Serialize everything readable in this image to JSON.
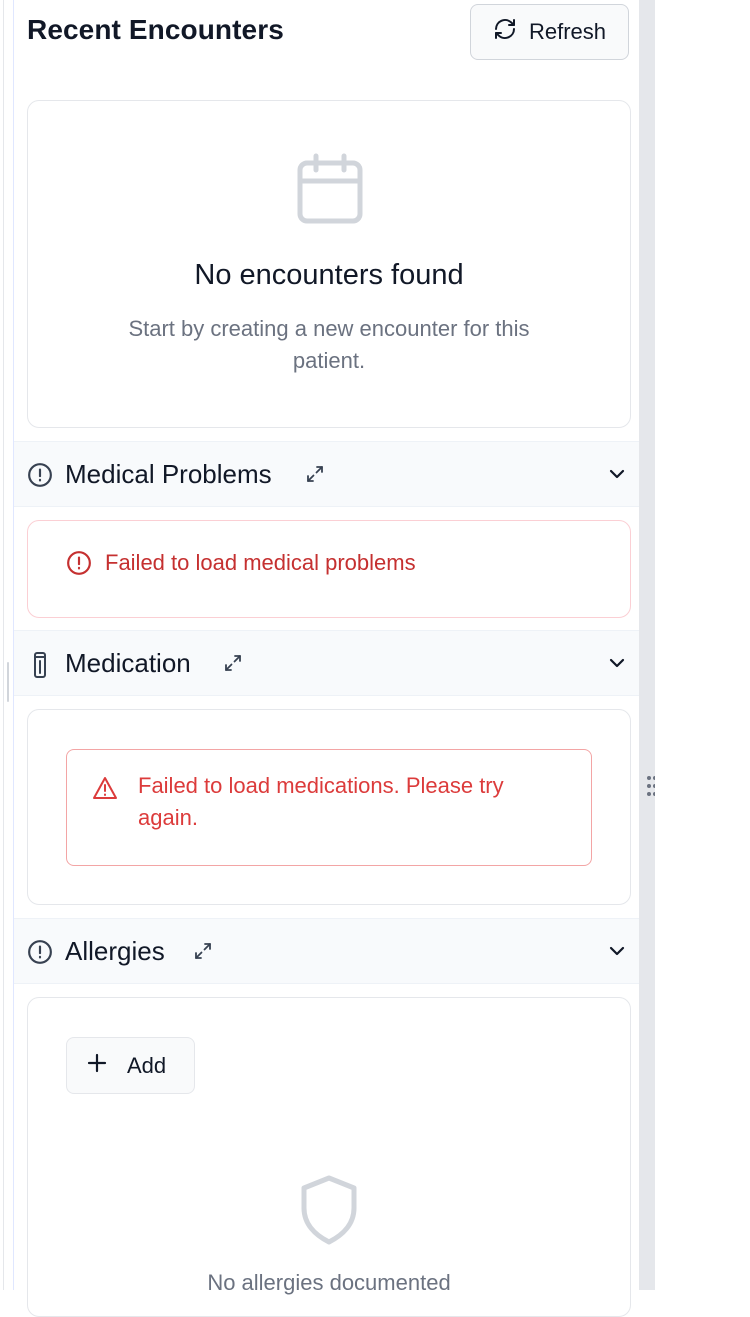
{
  "encounters": {
    "title": "Recent Encounters",
    "refresh_label": "Refresh",
    "empty_title": "No encounters found",
    "empty_subtitle": "Start by creating a new encounter for this patient."
  },
  "sections": {
    "medical_problems": {
      "title": "Medical Problems",
      "error": "Failed to load medical problems"
    },
    "medication": {
      "title": "Medication",
      "error": "Failed to load medications. Please try again."
    },
    "allergies": {
      "title": "Allergies",
      "add_label": "Add",
      "empty_text": "No allergies documented"
    }
  },
  "icons": {
    "refresh": "refresh-icon",
    "calendar": "calendar-icon",
    "alert_circle": "alert-circle-icon",
    "pill": "pill-icon",
    "expand": "expand-icon",
    "chevron": "chevron-down-icon",
    "warning": "warning-triangle-icon",
    "plus": "plus-icon",
    "shield": "shield-icon",
    "drag": "drag-handle-icon"
  },
  "colors": {
    "error_text": "#c53030",
    "alert_text": "#dc3b3b",
    "muted_text": "#6b7280",
    "header_bg": "#f8fafc"
  }
}
